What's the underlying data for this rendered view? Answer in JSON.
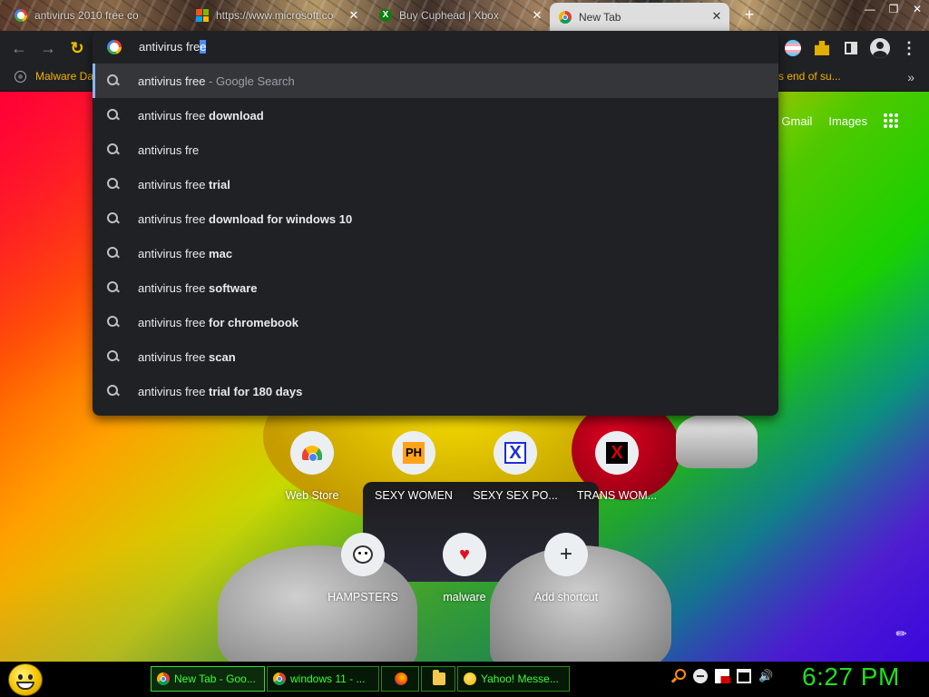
{
  "window": {
    "tabs": [
      {
        "title": "antivirus 2010 free co",
        "icon": "google-icon"
      },
      {
        "title": "https://www.microsoft.co",
        "icon": "microsoft-icon"
      },
      {
        "title": "Buy Cuphead | Xbox",
        "icon": "xbox-icon"
      },
      {
        "title": "New Tab",
        "icon": "chrome-icon",
        "active": true
      }
    ],
    "new_tab_label": "+",
    "controls": {
      "minimize": "—",
      "restore": "❐",
      "close": "✕"
    }
  },
  "toolbar": {
    "back": "←",
    "forward": "→",
    "reload": "↻",
    "menu": "⋮"
  },
  "bookmarks": {
    "items": [
      {
        "label": "Malware Da"
      },
      {
        "label": "s end of su..."
      }
    ],
    "more": "»"
  },
  "omnibox": {
    "typed_prefix": "antivirus fre",
    "selected_suffix": "e",
    "suggestions": [
      {
        "plain": "antivirus free",
        "bold": "",
        "hint": " - Google Search"
      },
      {
        "plain": "antivirus free ",
        "bold": "download",
        "hint": ""
      },
      {
        "plain": "antivirus fre",
        "bold": "",
        "hint": ""
      },
      {
        "plain": "antivirus free ",
        "bold": "trial",
        "hint": ""
      },
      {
        "plain": "antivirus free ",
        "bold": "download for windows 10",
        "hint": ""
      },
      {
        "plain": "antivirus free ",
        "bold": "mac",
        "hint": ""
      },
      {
        "plain": "antivirus free ",
        "bold": "software",
        "hint": ""
      },
      {
        "plain": "antivirus free ",
        "bold": "for chromebook",
        "hint": ""
      },
      {
        "plain": "antivirus free ",
        "bold": "scan",
        "hint": ""
      },
      {
        "plain": "antivirus free ",
        "bold": "trial for 180 days",
        "hint": ""
      }
    ]
  },
  "ntp": {
    "links": {
      "gmail": "Gmail",
      "images": "Images"
    },
    "shortcuts_row1": [
      {
        "label": "Web Store",
        "icon": "web-store-icon"
      },
      {
        "label": "SEXY WOMEN",
        "icon": "ph-icon",
        "glyph": "PH"
      },
      {
        "label": "SEXY SEX PO...",
        "icon": "x-blue-icon",
        "glyph": "X"
      },
      {
        "label": "TRANS WOM...",
        "icon": "x-red-icon",
        "glyph": "X"
      }
    ],
    "shortcuts_row2": [
      {
        "label": "HAMPSTERS",
        "icon": "hamster-icon"
      },
      {
        "label": "malware",
        "icon": "heart-icon",
        "glyph": "♥"
      },
      {
        "label": "Add shortcut",
        "icon": "plus-icon",
        "glyph": "+"
      }
    ],
    "customize_icon": "✎"
  },
  "taskbar": {
    "tasks": [
      {
        "label": "New Tab - Goo...",
        "icon": "chrome-icon",
        "active": true
      },
      {
        "label": "windows 11 - ...",
        "icon": "chrome-icon"
      },
      {
        "label": "",
        "icon": "firefox-icon"
      },
      {
        "label": "",
        "icon": "folder-icon"
      },
      {
        "label": "Yahoo! Messe...",
        "icon": "yahoo-messenger-icon"
      }
    ],
    "clock": "6:27 PM"
  },
  "colors": {
    "accent_green": "#38ff38",
    "bookmark_text": "#f0b400",
    "omnibox_bg": "#202124",
    "selection": "#4c8bf5"
  }
}
